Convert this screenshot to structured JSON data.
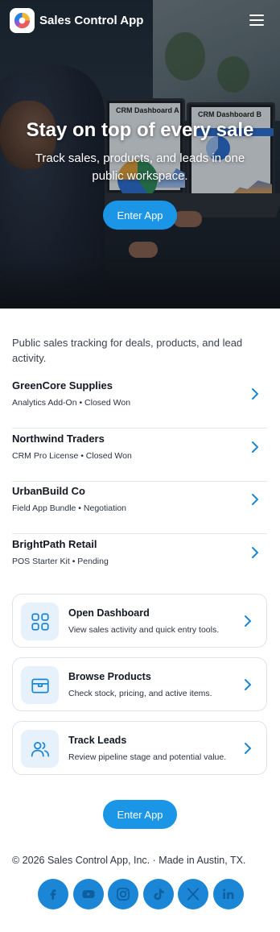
{
  "header": {
    "app_name": "Sales Control App",
    "logo_icon": "app-logo-pie",
    "menu_icon": "hamburger-menu-icon"
  },
  "hero": {
    "title": "Stay on top of every sale",
    "subtitle": "Track sales, products, and leads in one public workspace.",
    "cta_label": "Enter App",
    "screen_a_title": "CRM Dashboard A",
    "screen_b_title": "CRM Dashboard B"
  },
  "intro": "Public sales tracking for deals, products, and lead activity.",
  "deals": [
    {
      "name": "GreenCore Supplies",
      "meta": "Analytics Add-On • Closed Won"
    },
    {
      "name": "Northwind Traders",
      "meta": "CRM Pro License • Closed Won"
    },
    {
      "name": "UrbanBuild Co",
      "meta": "Field App Bundle • Negotiation"
    },
    {
      "name": "BrightPath Retail",
      "meta": "POS Starter Kit • Pending"
    }
  ],
  "cards": [
    {
      "title": "Open Dashboard",
      "subtitle": "View sales activity and quick entry tools.",
      "icon": "dashboard-grid-icon"
    },
    {
      "title": "Browse Products",
      "subtitle": "Check stock, pricing, and active items.",
      "icon": "box-icon"
    },
    {
      "title": "Track Leads",
      "subtitle": "Review pipeline stage and potential value.",
      "icon": "users-icon"
    }
  ],
  "bottom_cta_label": "Enter App",
  "footer": {
    "copyright": "© 2026 Sales Control App, Inc. · Made in Austin, TX."
  },
  "socials": [
    "facebook-icon",
    "youtube-icon",
    "instagram-icon",
    "tiktok-icon",
    "x-icon",
    "linkedin-icon"
  ],
  "colors": {
    "accent": "#1b96e6",
    "social": "#1b86d6",
    "icon_tile": "#e6f1fb",
    "chevron": "#1b86d6"
  }
}
